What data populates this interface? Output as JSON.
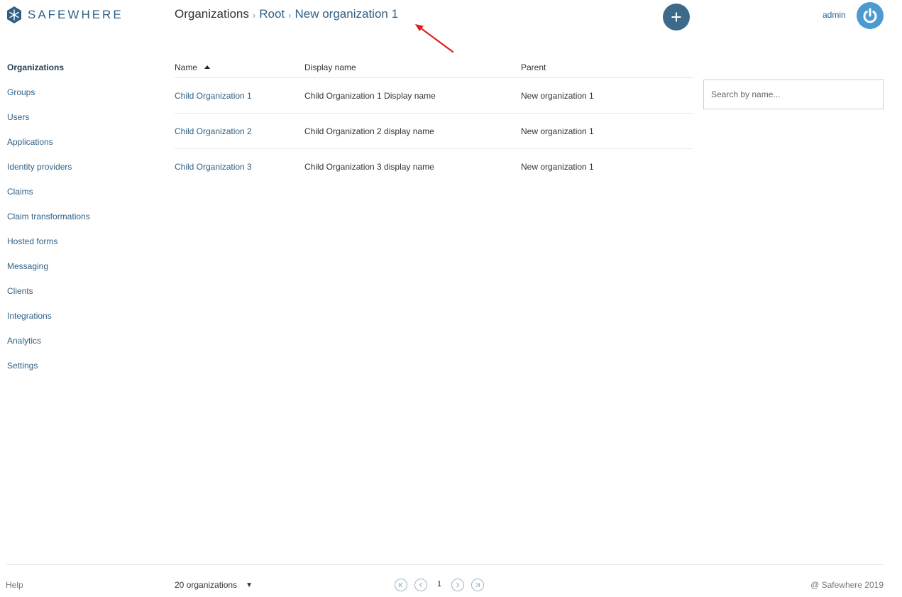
{
  "header": {
    "logo_text": "SAFEWHERE",
    "breadcrumb": [
      "Organizations",
      "Root",
      "New organization 1"
    ],
    "user_name": "admin",
    "add_icon": "plus-icon",
    "power_icon": "power-icon"
  },
  "sidebar": {
    "items": [
      {
        "label": "Organizations",
        "active": true
      },
      {
        "label": "Groups"
      },
      {
        "label": "Users"
      },
      {
        "label": "Applications"
      },
      {
        "label": "Identity providers"
      },
      {
        "label": "Claims"
      },
      {
        "label": "Claim transformations"
      },
      {
        "label": "Hosted forms"
      },
      {
        "label": "Messaging"
      },
      {
        "label": "Clients"
      },
      {
        "label": "Integrations"
      },
      {
        "label": "Analytics"
      },
      {
        "label": "Settings"
      }
    ]
  },
  "table": {
    "columns": [
      "Name",
      "Display name",
      "Parent"
    ],
    "rows": [
      {
        "name": "Child Organization 1",
        "display_name": "Child Organization 1 Display name",
        "parent": "New organization 1"
      },
      {
        "name": "Child Organization 2",
        "display_name": "Child Organization 2 display name",
        "parent": "New organization 1"
      },
      {
        "name": "Child Organization 3",
        "display_name": "Child Organization 3 display name",
        "parent": "New organization 1"
      }
    ]
  },
  "search": {
    "placeholder": "Search by name..."
  },
  "footer": {
    "help": "Help",
    "page_size": "20 organizations",
    "current_page": "1",
    "copyright": "@ Safewhere 2019"
  },
  "colors": {
    "brand": "#2f5f84",
    "add_button": "#3d6a8a",
    "power_button": "#4c9bd0",
    "annotation_arrow": "#e0201c"
  }
}
